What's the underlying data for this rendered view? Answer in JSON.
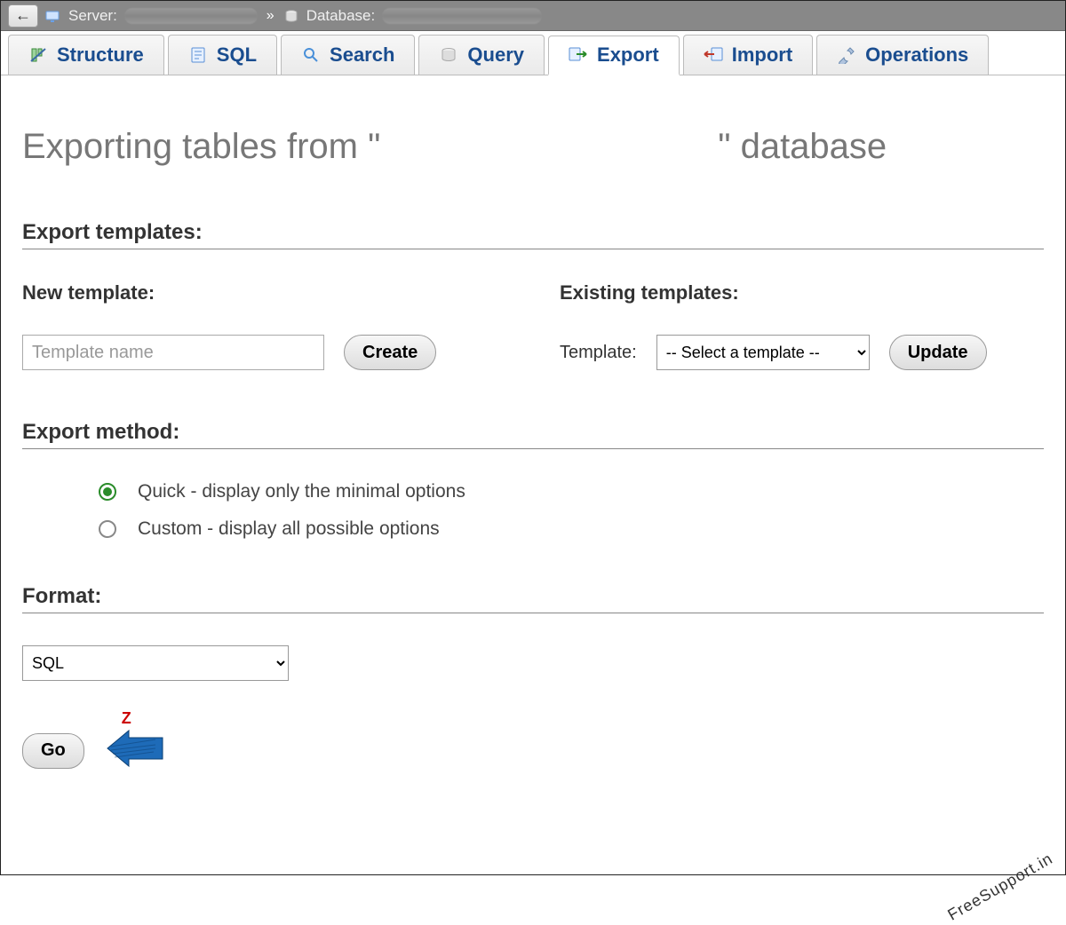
{
  "breadcrumb": {
    "back_arrow": "←",
    "server_label": "Server:",
    "database_label": "Database:"
  },
  "tabs": [
    {
      "id": "structure",
      "label": "Structure",
      "active": false
    },
    {
      "id": "sql",
      "label": "SQL",
      "active": false
    },
    {
      "id": "search",
      "label": "Search",
      "active": false
    },
    {
      "id": "query",
      "label": "Query",
      "active": false
    },
    {
      "id": "export",
      "label": "Export",
      "active": true
    },
    {
      "id": "import",
      "label": "Import",
      "active": false
    },
    {
      "id": "operations",
      "label": "Operations",
      "active": false
    }
  ],
  "page": {
    "title_prefix": "Exporting tables from \"",
    "title_suffix": "\" database",
    "db_name_redacted": "",
    "export_templates_heading": "Export templates:",
    "new_template_heading": "New template:",
    "existing_templates_heading": "Existing templates:",
    "template_name_placeholder": "Template name",
    "create_button": "Create",
    "template_label": "Template:",
    "template_select_placeholder": "-- Select a template --",
    "update_button": "Update",
    "export_method_heading": "Export method:",
    "method_quick": "Quick - display only the minimal options",
    "method_custom": "Custom - display all possible options",
    "method_selected": "quick",
    "format_heading": "Format:",
    "format_selected": "SQL",
    "format_options": [
      "SQL"
    ],
    "go_button": "Go",
    "annotation_letter": "Z",
    "watermark": "FreeSupport.in"
  }
}
